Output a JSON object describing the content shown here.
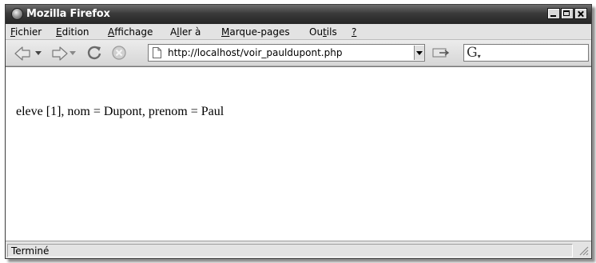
{
  "window": {
    "title": "Mozilla Firefox",
    "icon": "firefox-icon"
  },
  "menu": {
    "items": [
      {
        "label": "Fichier",
        "accel": "F"
      },
      {
        "label": "Edition",
        "accel": "E"
      },
      {
        "label": "Affichage",
        "accel": "A"
      },
      {
        "label": "Aller à",
        "accel": "l"
      },
      {
        "label": "Marque-pages",
        "accel": "M"
      },
      {
        "label": "Outils",
        "accel": "t"
      },
      {
        "label": "?",
        "accel": "?"
      }
    ]
  },
  "toolbar": {
    "back_icon": "back-arrow-icon",
    "forward_icon": "forward-arrow-icon",
    "reload_icon": "reload-icon",
    "stop_icon": "stop-icon",
    "go_icon": "go-icon"
  },
  "address": {
    "url": "http://localhost/voir_pauldupont.php"
  },
  "search": {
    "engine_icon": "google-g-icon",
    "value": ""
  },
  "content": {
    "text": "eleve [1], nom = Dupont, prenom = Paul"
  },
  "status": {
    "text": "Terminé"
  },
  "colors": {
    "titlebar": "#2e2e2e",
    "chrome": "#e3e3e3",
    "page_background": "#ffffff"
  }
}
